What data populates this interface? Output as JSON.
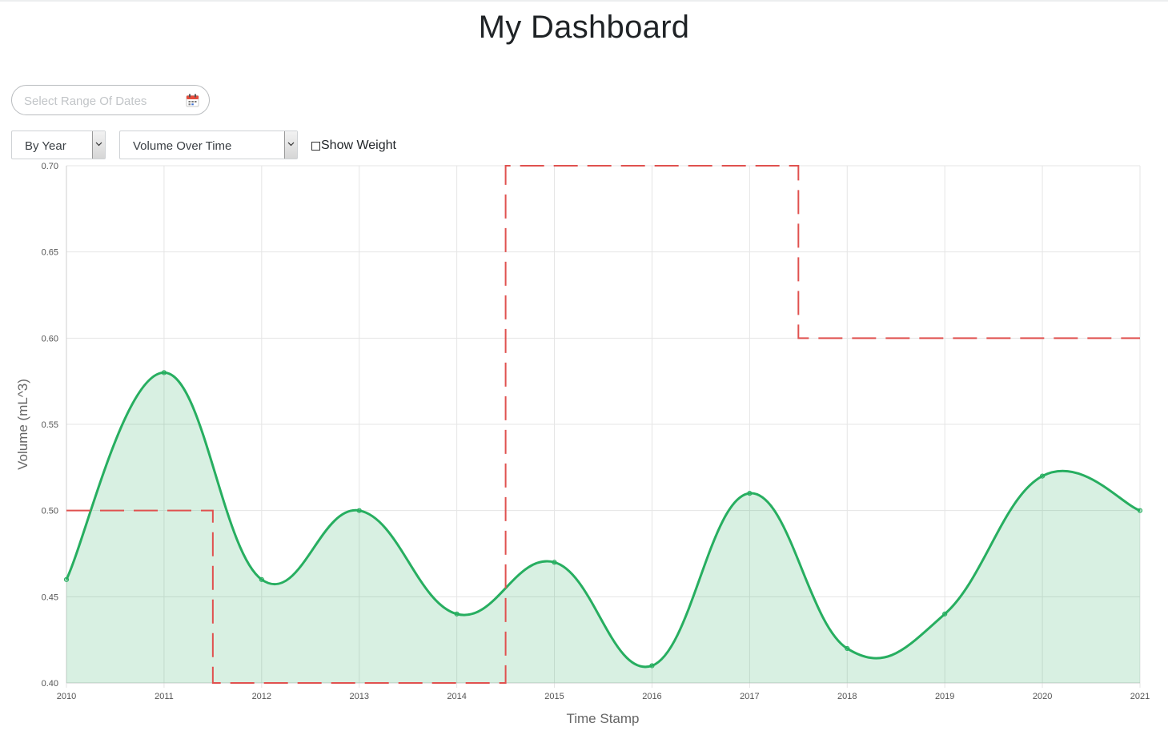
{
  "page": {
    "title": "My Dashboard"
  },
  "controls": {
    "date_range": {
      "placeholder": "Select Range Of Dates",
      "icon": "calendar-icon"
    },
    "granularity_select": {
      "value": "By Year",
      "icon": "chevron-down-icon"
    },
    "metric_select": {
      "value": "Volume Over Time",
      "icon": "chevron-down-icon"
    },
    "show_weight": {
      "label": "Show Weight",
      "checked": false
    }
  },
  "colors": {
    "series_line": "#27ae60",
    "series_fill": "rgba(39,174,96,0.18)",
    "threshold_line": "#e0514f",
    "grid": "#e5e5e5"
  },
  "chart_data": {
    "type": "area",
    "title": "",
    "xlabel": "Time Stamp",
    "ylabel": "Volume (mL^3)",
    "x": [
      "2010",
      "2011",
      "2012",
      "2013",
      "2014",
      "2015",
      "2016",
      "2017",
      "2018",
      "2019",
      "2020",
      "2021"
    ],
    "ylim": [
      0.4,
      0.7
    ],
    "yticks": [
      "0.40",
      "0.45",
      "0.50",
      "0.55",
      "0.60",
      "0.65",
      "0.70"
    ],
    "grid": true,
    "series": [
      {
        "values": [
          0.46,
          0.58,
          0.46,
          0.5,
          0.44,
          0.47,
          0.41,
          0.51,
          0.42,
          0.44,
          0.52,
          0.5
        ],
        "smooth": true,
        "filled": true
      }
    ],
    "threshold_steps": [
      {
        "from_x": 2010,
        "to_x": 2011.5,
        "y": 0.5
      },
      {
        "from_x": 2011.5,
        "to_x": 2014.5,
        "y": 0.4
      },
      {
        "from_x": 2014.5,
        "to_x": 2017.5,
        "y": 0.7
      },
      {
        "from_x": 2017.5,
        "to_x": 2021,
        "y": 0.6
      }
    ]
  }
}
